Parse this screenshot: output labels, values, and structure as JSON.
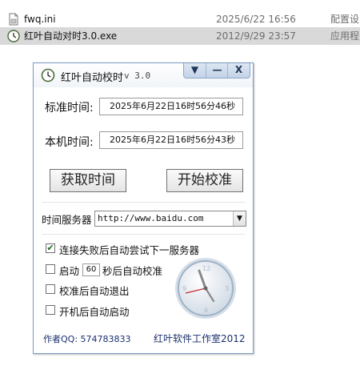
{
  "explorer": {
    "rows": [
      {
        "name": "fwq.ini",
        "date": "2025/6/22 16:56",
        "type": "配置设",
        "icon": "ini-file-icon"
      },
      {
        "name": "红叶自动对时3.0.exe",
        "date": "2012/9/29 23:57",
        "type": "应用程",
        "icon": "clock-app-icon"
      }
    ]
  },
  "window": {
    "title": "红叶自动校时",
    "version": "v 3.0",
    "titlebar_buttons": [
      "▼",
      "—",
      "X"
    ],
    "standard_time_label": "标准时间:",
    "standard_time_value": "2025年6月22日16时56分46秒",
    "local_time_label": "本机时间:",
    "local_time_value": "2025年6月22日16时56分43秒",
    "get_time_button": "获取时间",
    "start_sync_button": "开始校准",
    "server_label": "时间服务器",
    "server_value": "http://www.baidu.com",
    "options": {
      "retry_next_server": {
        "label": "连接失败后自动尝试下一服务器",
        "checked": true
      },
      "auto_sync_prefix": "启动",
      "auto_sync_seconds": "60",
      "auto_sync_suffix": "秒后自动校准",
      "auto_sync_checked": false,
      "exit_after_sync": {
        "label": "校准后自动退出",
        "checked": false
      },
      "start_on_boot": {
        "label": "开机后自动启动",
        "checked": false
      }
    },
    "author_qq": "作者QQ: 574783833",
    "studio": "红叶软件工作室2012"
  },
  "colors": {
    "selected_row": "#d9d9d9",
    "window_border": "#7a9ac4",
    "footer_text": "#1a2f6e"
  }
}
